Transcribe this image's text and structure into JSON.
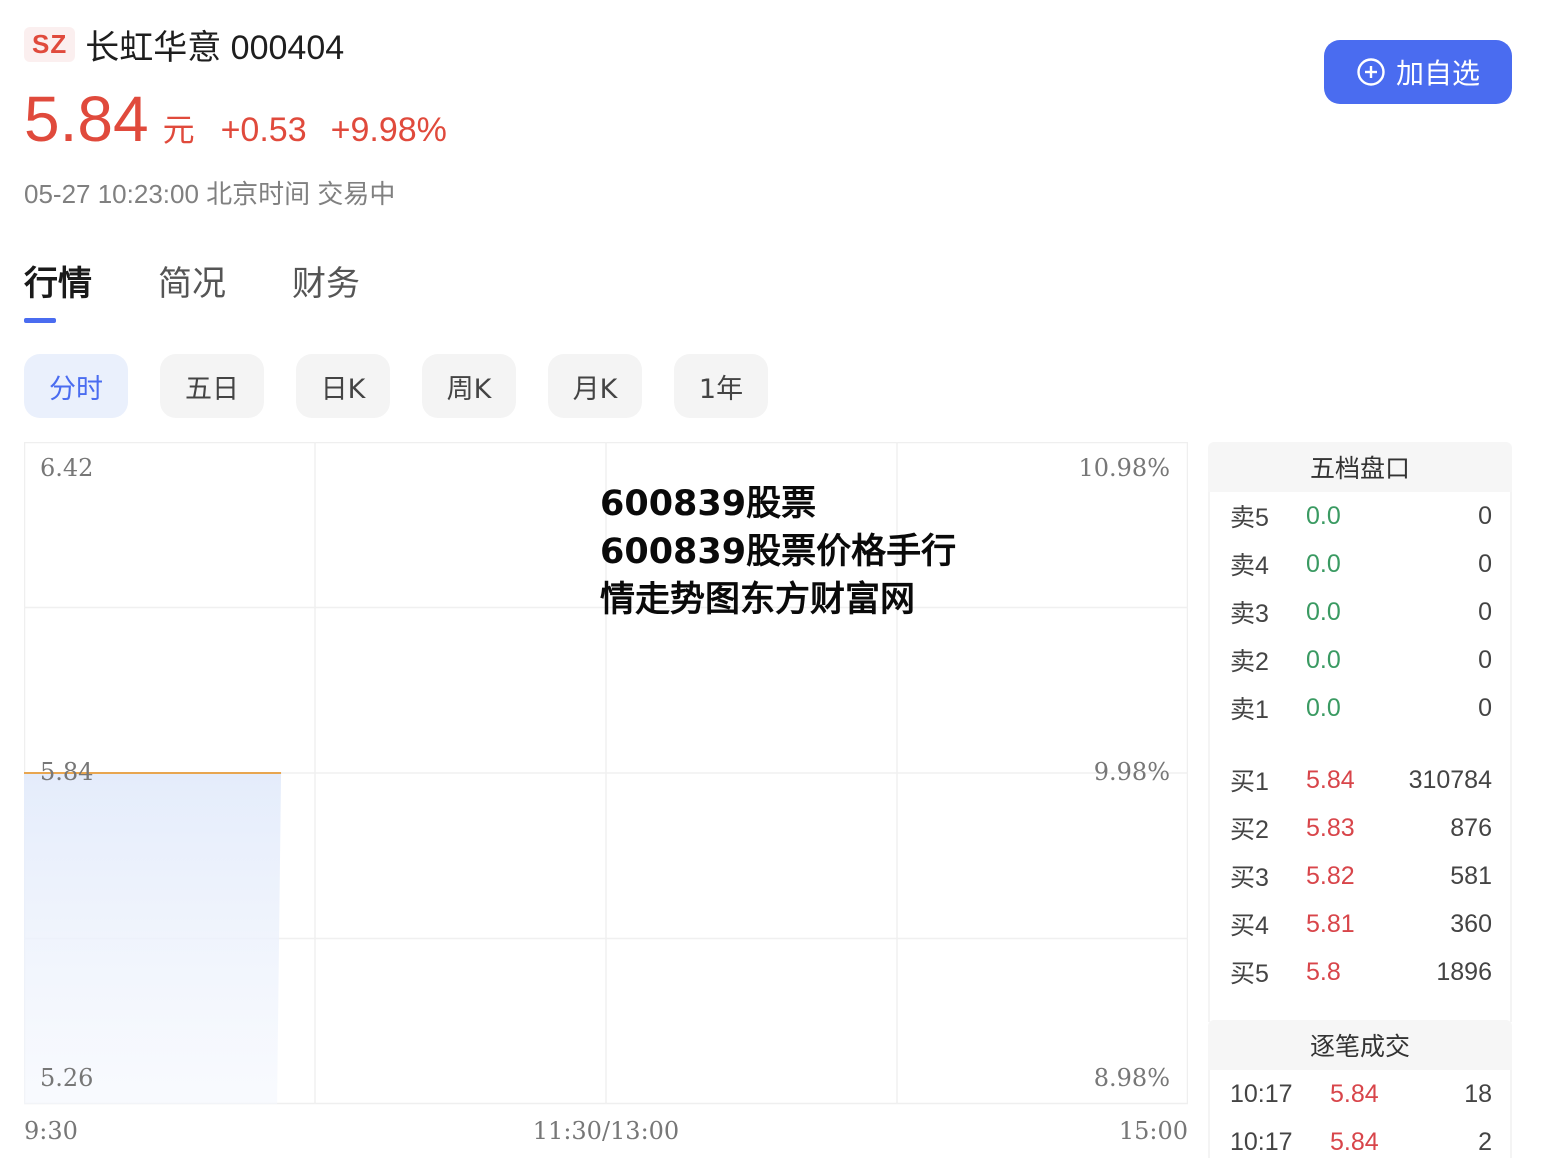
{
  "header": {
    "market": "SZ",
    "name_code": "长虹华意 000404",
    "price": "5.84",
    "unit": "元",
    "change": "+0.53",
    "change_pct": "+9.98%",
    "timestamp": "05-27 10:23:00 北京时间 交易中",
    "add_watchlist_label": "加自选",
    "accent_color": "#4a6cf0",
    "up_color": "#e04a3c",
    "down_color": "#3a9a62"
  },
  "tabs": [
    {
      "label": "行情",
      "active": true
    },
    {
      "label": "简况",
      "active": false
    },
    {
      "label": "财务",
      "active": false
    }
  ],
  "periods": [
    {
      "label": "分时",
      "active": true
    },
    {
      "label": "五日",
      "active": false
    },
    {
      "label": "日K",
      "active": false
    },
    {
      "label": "周K",
      "active": false
    },
    {
      "label": "月K",
      "active": false
    },
    {
      "label": "1年",
      "active": false
    }
  ],
  "watermark": "600839股票 600839股票价格手行情走势图东方财富网",
  "chart_data": {
    "type": "area",
    "title": "",
    "y_left_ticks": [
      "6.42",
      "5.84",
      "5.26"
    ],
    "y_right_ticks": [
      "10.98%",
      "9.98%",
      "8.98%"
    ],
    "x_ticks": [
      "9:30",
      "11:30/13:00",
      "15:00"
    ],
    "ylim": [
      5.26,
      6.42
    ],
    "prev_close_pct_ref": "9.98%",
    "session_minutes": 240,
    "series": [
      {
        "name": "price",
        "x_minutes": [
          0,
          53
        ],
        "values": [
          5.84,
          5.84
        ],
        "color": "#e8a650"
      }
    ],
    "grid": true
  },
  "order_book": {
    "title": "五档盘口",
    "asks": [
      {
        "label": "卖5",
        "price": "0.0",
        "vol": "0"
      },
      {
        "label": "卖4",
        "price": "0.0",
        "vol": "0"
      },
      {
        "label": "卖3",
        "price": "0.0",
        "vol": "0"
      },
      {
        "label": "卖2",
        "price": "0.0",
        "vol": "0"
      },
      {
        "label": "卖1",
        "price": "0.0",
        "vol": "0"
      }
    ],
    "bids": [
      {
        "label": "买1",
        "price": "5.84",
        "vol": "310784"
      },
      {
        "label": "买2",
        "price": "5.83",
        "vol": "876"
      },
      {
        "label": "买3",
        "price": "5.82",
        "vol": "581"
      },
      {
        "label": "买4",
        "price": "5.81",
        "vol": "360"
      },
      {
        "label": "买5",
        "price": "5.8",
        "vol": "1896"
      }
    ]
  },
  "trades": {
    "title": "逐笔成交",
    "rows": [
      {
        "time": "10:17",
        "price": "5.84",
        "vol": "18"
      },
      {
        "time": "10:17",
        "price": "5.84",
        "vol": "2"
      }
    ]
  }
}
